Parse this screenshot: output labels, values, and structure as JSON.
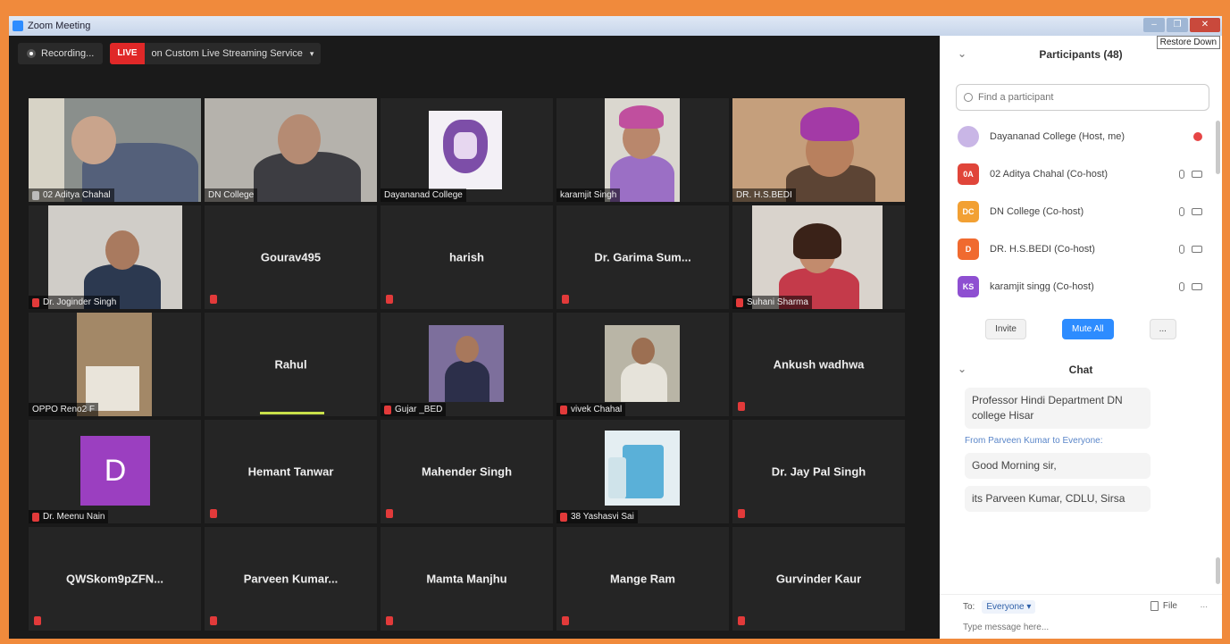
{
  "window": {
    "title": "Zoom Meeting"
  },
  "window_controls": {
    "minimize": "",
    "restore": "",
    "close": "",
    "tooltip": "Restore Down"
  },
  "topbar": {
    "recording": "Recording...",
    "live_badge": "LIVE",
    "live_service": "on Custom Live Streaming Service",
    "caret": "▾"
  },
  "tiles": [
    {
      "label": "02 Aditya Chahal",
      "mic": "on"
    },
    {
      "label": "DN College",
      "mic": "none"
    },
    {
      "label": "Dayananad College",
      "mic": "none"
    },
    {
      "label": "karamjit Singh",
      "mic": "none"
    },
    {
      "label": "DR. H.S.BEDI",
      "mic": "none"
    },
    {
      "label": "Dr. Joginder Singh",
      "mic": "muted"
    },
    {
      "center": "Gourav495",
      "mic": "muted"
    },
    {
      "center": "harish",
      "mic": "muted"
    },
    {
      "center": "Dr. Garima Sum...",
      "mic": "muted"
    },
    {
      "label": "Suhani Sharma",
      "mic": "muted"
    },
    {
      "label": "OPPO Reno2 F",
      "mic": "none"
    },
    {
      "center": "Rahul",
      "mic": "none"
    },
    {
      "label": "Gujar _BED",
      "mic": "muted"
    },
    {
      "label": "vivek Chahal",
      "mic": "muted"
    },
    {
      "center": "Ankush wadhwa",
      "mic": "muted"
    },
    {
      "label": "Dr. Meenu Nain",
      "avatar": "D",
      "mic": "muted"
    },
    {
      "center": "Hemant Tanwar",
      "mic": "muted"
    },
    {
      "center": "Mahender Singh",
      "mic": "muted"
    },
    {
      "label": "38 Yashasvi Sai",
      "mic": "muted"
    },
    {
      "center": "Dr. Jay Pal Singh",
      "mic": "muted"
    },
    {
      "center": "QWSkom9pZFN...",
      "mic": "muted"
    },
    {
      "center": "Parveen  Kumar...",
      "mic": "muted"
    },
    {
      "center": "Mamta Manjhu",
      "mic": "muted"
    },
    {
      "center": "Mange Ram",
      "mic": "muted"
    },
    {
      "center": "Gurvinder Kaur",
      "mic": "muted"
    }
  ],
  "participants": {
    "title": "Participants (48)",
    "search_placeholder": "Find a participant",
    "list": [
      {
        "initials": "",
        "name": "Dayananad College (Host, me)",
        "color": "#c9b6e6"
      },
      {
        "initials": "0A",
        "name": "02 Aditya Chahal (Co-host)",
        "color": "#e0453a"
      },
      {
        "initials": "DC",
        "name": "DN College (Co-host)",
        "color": "#f2a033"
      },
      {
        "initials": "D",
        "name": "DR. H.S.BEDI (Co-host)",
        "color": "#f06a2f"
      },
      {
        "initials": "KS",
        "name": "karamjit singg (Co-host)",
        "color": "#8e4fd1"
      }
    ],
    "invite": "Invite",
    "mute_all": "Mute All",
    "more": "..."
  },
  "chat": {
    "title": "Chat",
    "message1": "Professor Hindi Department DN college Hisar",
    "from": "From Parveen Kumar to Everyone:",
    "message2": "Good Morning sir,",
    "message3": "its Parveen Kumar, CDLU, Sirsa",
    "to_label": "To:",
    "to_value": "Everyone ▾",
    "file": "File",
    "more": "...",
    "input_placeholder": "Type message here..."
  }
}
